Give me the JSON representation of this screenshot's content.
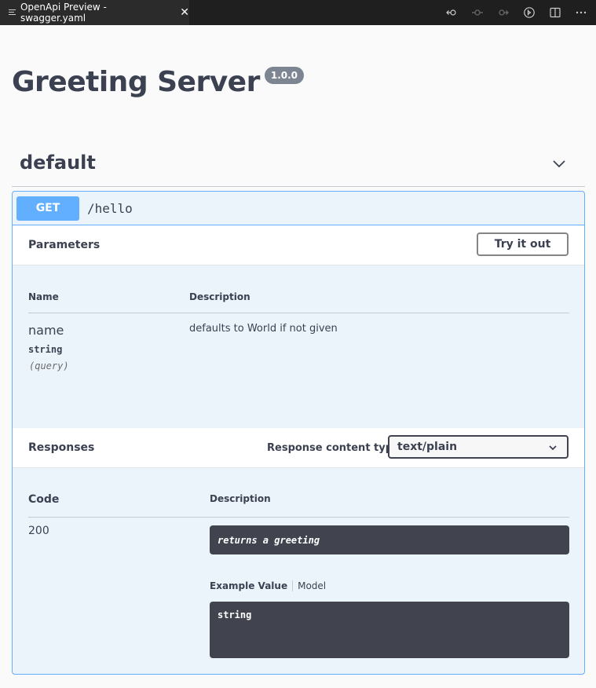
{
  "tabbar": {
    "tab_label": "OpenApi Preview - swagger.yaml",
    "close_glyph": "✕",
    "actions": [
      "go-back-icon",
      "git-commit-icon",
      "go-forward-icon",
      "open-changes-icon",
      "split-editor-icon",
      "more-actions-icon"
    ]
  },
  "header": {
    "title": "Greeting Server",
    "version": "1.0.0"
  },
  "section": {
    "name": "default",
    "expanded": true
  },
  "operation": {
    "method": "GET",
    "path": "/hello",
    "method_color": "#61affe"
  },
  "parameters": {
    "heading": "Parameters",
    "try_label": "Try it out",
    "col_name": "Name",
    "col_description": "Description",
    "items": [
      {
        "name": "name",
        "type": "string",
        "in": "(query)",
        "description": "defaults to World if not given"
      }
    ]
  },
  "responses": {
    "heading": "Responses",
    "content_type_label": "Response content type",
    "content_type_value": "text/plain",
    "col_code": "Code",
    "col_description": "Description",
    "items": [
      {
        "code": "200",
        "description": "returns a greeting",
        "example_tab": "Example Value",
        "model_tab": "Model",
        "example": "string"
      }
    ]
  }
}
